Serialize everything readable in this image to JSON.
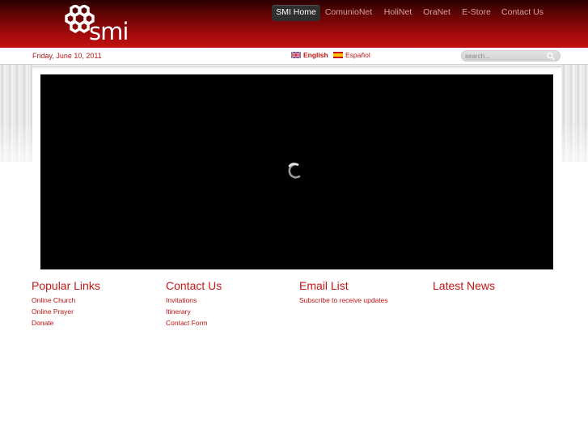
{
  "header": {
    "logo_text": "smi",
    "nav": [
      {
        "label": "SMI Home",
        "active": true
      },
      {
        "label": "ComunioNet",
        "active": false
      },
      {
        "label": "HoliNet",
        "active": false
      },
      {
        "label": "OraNet",
        "active": false
      },
      {
        "label": "E-Store",
        "active": false
      },
      {
        "label": "Contact Us",
        "active": false
      }
    ]
  },
  "subbar": {
    "date": "Friday, June 10, 2011",
    "languages": [
      {
        "label": "English",
        "flag": "uk-flag-icon",
        "selected": true
      },
      {
        "label": "Español",
        "flag": "spain-flag-icon",
        "selected": false
      }
    ],
    "search": {
      "placeholder": "search...",
      "value": "",
      "icon": "search-icon"
    }
  },
  "video": {
    "state": "loading",
    "icon": "loading-spinner-icon"
  },
  "footer": {
    "columns": [
      {
        "title": "Popular Links",
        "links": [
          "Online Church",
          "Online Prayer",
          "Donate"
        ]
      },
      {
        "title": "Contact Us",
        "links": [
          "Invitations",
          "Itinerary",
          "Contact Form"
        ]
      },
      {
        "title": "Email List",
        "links": [
          "Subscribe to receive updates"
        ]
      },
      {
        "title": "Latest News",
        "links": []
      }
    ]
  },
  "colors": {
    "brand_red": "#c21212",
    "header_dark": "#2a0000",
    "nav_active_bg": "#2f2f2f",
    "video_bg": "#000000"
  }
}
